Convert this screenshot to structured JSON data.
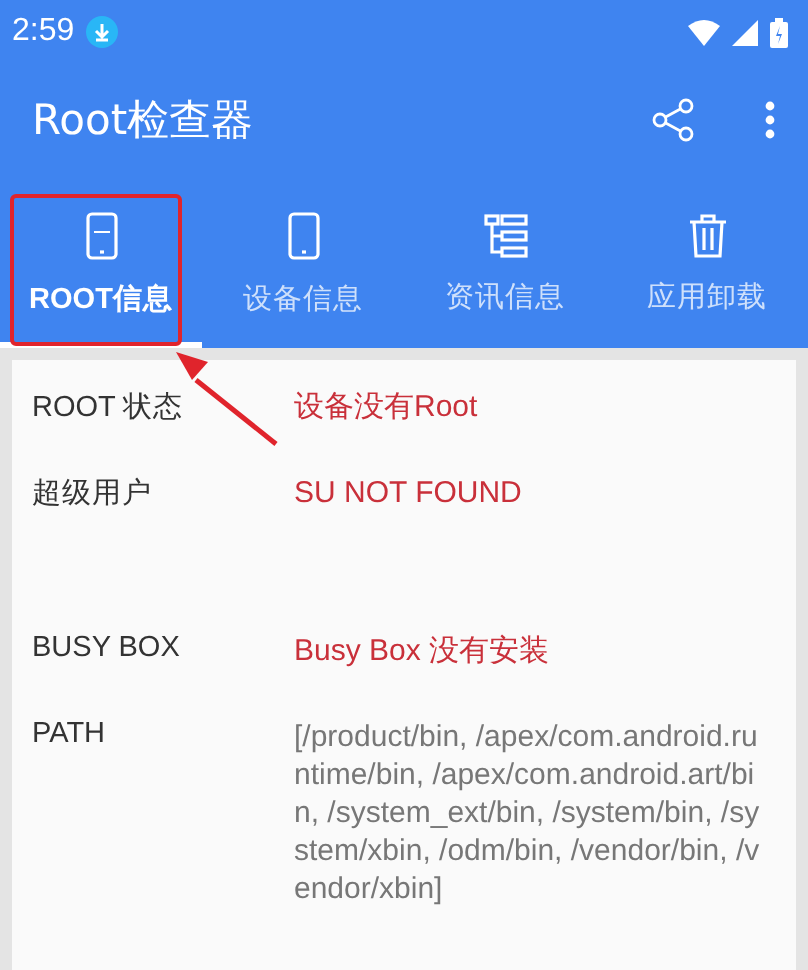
{
  "status_bar": {
    "time": "2:59"
  },
  "app_bar": {
    "title": "Root检查器"
  },
  "tabs": [
    {
      "label": "ROOT信息",
      "selected": true,
      "highlighted": true
    },
    {
      "label": "设备信息",
      "selected": false,
      "highlighted": false
    },
    {
      "label": "资讯信息",
      "selected": false,
      "highlighted": false
    },
    {
      "label": "应用卸载",
      "selected": false,
      "highlighted": false
    }
  ],
  "rows": [
    {
      "label": "ROOT 状态",
      "value": "设备没有Root",
      "kind": "alert"
    },
    {
      "label": "超级用户",
      "value": "SU NOT FOUND",
      "kind": "alert"
    },
    {
      "label": "BUSY BOX",
      "value": "Busy Box 没有安装",
      "kind": "alert"
    },
    {
      "label": "PATH",
      "value": "[/product/bin, /apex/com.android.runtime/bin, /apex/com.android.art/bin, /system_ext/bin, /system/bin, /system/xbin, /odm/bin, /vendor/bin, /vendor/xbin]",
      "kind": "plain"
    }
  ]
}
